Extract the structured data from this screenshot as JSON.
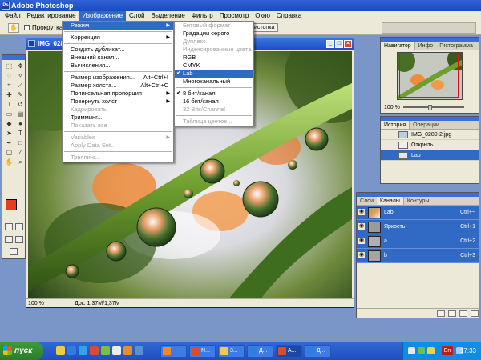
{
  "app": {
    "title": "Adobe Photoshop"
  },
  "menubar": {
    "items": [
      "Файл",
      "Редактирование",
      "Изображение",
      "Слой",
      "Выделение",
      "Фильтр",
      "Просмотр",
      "Окно",
      "Справка"
    ],
    "active_index": 2
  },
  "options": {
    "checkbox_label": "Прокрутка",
    "button_label": "истопка"
  },
  "document": {
    "title": "IMG_0280-",
    "zoom": "100 %",
    "doc_info": "Док: 1,37M/1,37M"
  },
  "image_menu": {
    "items": [
      {
        "label": "Режим",
        "submenu": true,
        "active": true
      },
      {
        "sep": true
      },
      {
        "label": "Коррекция",
        "submenu": true
      },
      {
        "sep": true
      },
      {
        "label": "Создать дубликат..."
      },
      {
        "label": "Внешний канал..."
      },
      {
        "label": "Вычисления..."
      },
      {
        "sep": true
      },
      {
        "label": "Размер изображения...",
        "shortcut": "Alt+Ctrl+I"
      },
      {
        "label": "Размер холста...",
        "shortcut": "Alt+Ctrl+C"
      },
      {
        "label": "Попиксельная пропорция",
        "submenu": true
      },
      {
        "label": "Повернуть холст",
        "submenu": true
      },
      {
        "label": "Кадрировать",
        "disabled": true
      },
      {
        "label": "Тримминг..."
      },
      {
        "label": "Показать все",
        "disabled": true
      },
      {
        "sep": true
      },
      {
        "label": "Variables",
        "submenu": true,
        "disabled": true
      },
      {
        "label": "Apply Data Set...",
        "disabled": true
      },
      {
        "sep": true
      },
      {
        "label": "Треппинг...",
        "disabled": true
      }
    ]
  },
  "mode_menu": {
    "items": [
      {
        "label": "Битовый формат",
        "disabled": true
      },
      {
        "label": "Градации серого"
      },
      {
        "label": "Дуплекс",
        "disabled": true
      },
      {
        "label": "Индексированные цвета",
        "disabled": true
      },
      {
        "label": "RGB"
      },
      {
        "label": "CMYK"
      },
      {
        "label": "Lab",
        "checked": true,
        "active": true
      },
      {
        "label": "Многоканальный"
      },
      {
        "sep": true
      },
      {
        "label": "8 бит/канал",
        "checked": true
      },
      {
        "label": "16 бит/канал"
      },
      {
        "label": "32 Bits/Channel",
        "disabled": true
      },
      {
        "sep": true
      },
      {
        "label": "Таблица цветов...",
        "disabled": true
      }
    ]
  },
  "navigator": {
    "tabs": [
      "Навигатор",
      "Инфо",
      "Гистограмма"
    ],
    "zoom": "100 %",
    "zoom_fraction": 0.45
  },
  "history": {
    "tabs": [
      "История",
      "Операции"
    ],
    "snapshot": "IMG_0280-2.jpg",
    "items": [
      {
        "label": "Открыть",
        "selected": false
      },
      {
        "label": "Lab",
        "selected": true
      }
    ]
  },
  "channels": {
    "tabs": [
      "Слои",
      "Каналы",
      "Контуры"
    ],
    "items": [
      {
        "label": "Lab",
        "shortcut": "Ctrl+~"
      },
      {
        "label": "Яркость",
        "shortcut": "Ctrl+1"
      },
      {
        "label": "a",
        "shortcut": "Ctrl+2"
      },
      {
        "label": "b",
        "shortcut": "Ctrl+3"
      }
    ]
  },
  "taskbar": {
    "start_label": "пуск",
    "tasks": [
      {
        "label": ""
      },
      {
        "label": "N..."
      },
      {
        "label": "3..."
      },
      {
        "label": "Д..."
      },
      {
        "label": "A..."
      },
      {
        "label": "Д..."
      }
    ],
    "lang": "En",
    "clock": "17:33"
  },
  "colors": {
    "foreground": "#e83c1f",
    "background": "#ffffff",
    "accent": "#316ac5"
  }
}
